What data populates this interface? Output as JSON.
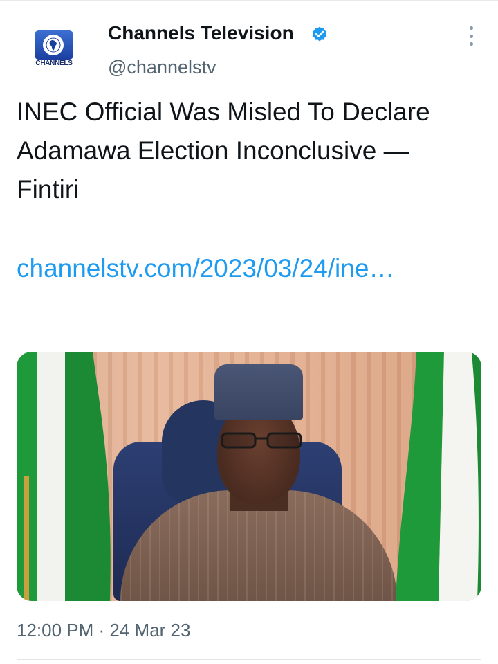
{
  "tweet": {
    "author": {
      "display_name": "Channels Television",
      "handle": "@channelstv",
      "verified": true,
      "avatar_logo_text": "CHANNELS"
    },
    "text": "INEC Official Was Misled To Declare Adamawa Election Inconclusive — Fintiri",
    "link_text": "channelstv.com/2023/03/24/ine…",
    "timestamp": "12:00 PM · 24 Mar 23",
    "more_icon": "more-vertical-icon",
    "verified_icon": "verified-badge-icon"
  },
  "colors": {
    "link": "#1d9bf0",
    "verified": "#1d9bf0",
    "secondary_text": "#536471",
    "primary_text": "#0f1419"
  }
}
